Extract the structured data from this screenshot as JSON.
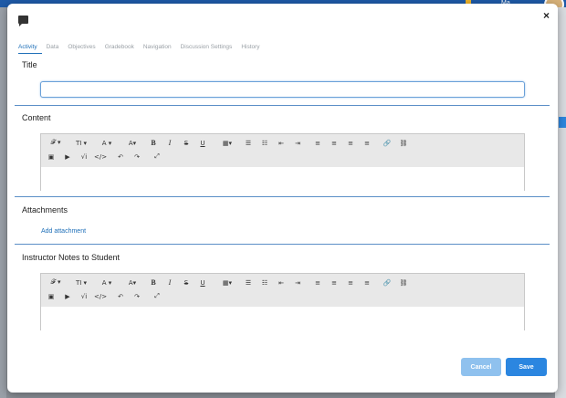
{
  "background": {
    "user_label": "Ma"
  },
  "modal": {
    "close_label": "×",
    "tabs": [
      "Activity",
      "Data",
      "Objectives",
      "Gradebook",
      "Navigation",
      "Discussion Settings",
      "History"
    ],
    "sections": {
      "title": "Title",
      "content": "Content",
      "attachments": "Attachments",
      "notes": "Instructor Notes to Student"
    },
    "title_input": {
      "value": "",
      "placeholder": ""
    },
    "attach_link": "Add attachment",
    "toolbar": {
      "font": "𝓕 ▾",
      "size": "TI ▾",
      "color": "A ▾",
      "bgcolor": "A▾",
      "bold": "B",
      "italic": "I",
      "strike": "S",
      "underline": "U",
      "table": "▦▾",
      "ul": "☰",
      "ol": "☷",
      "outdent": "⇤",
      "indent": "⇥",
      "align_left": "≡",
      "align_center": "≡",
      "align_right": "≡",
      "justify": "≡",
      "link": "🔗",
      "unlink": "⛓",
      "image": "▣",
      "video": "▶",
      "math": "√i",
      "code": "</>",
      "undo": "↶",
      "redo": "↷",
      "fullscreen": "⤢"
    },
    "buttons": {
      "cancel": "Cancel",
      "save": "Save"
    },
    "colors": {
      "accent": "#2b86e0",
      "cancel": "#8fc1ee",
      "divider": "#5b8fc7"
    }
  }
}
